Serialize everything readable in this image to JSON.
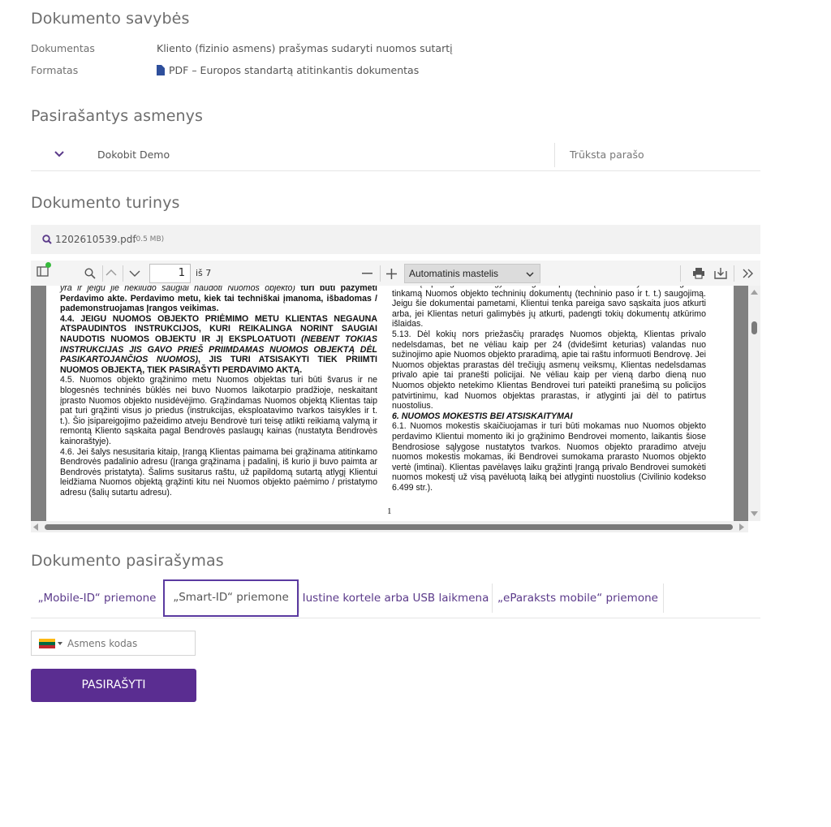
{
  "properties": {
    "title": "Dokumento savybės",
    "doc_label": "Dokumentas",
    "doc_value": "Kliento (fizinio asmens) prašymas sudaryti nuomos sutartį",
    "format_label": "Formatas",
    "format_value": "PDF – Europos standartą atitinkantis dokumentas"
  },
  "signers": {
    "title": "Pasirašantys asmenys",
    "rows": [
      {
        "name": "Dokobit Demo",
        "status": "Trūksta parašo"
      }
    ]
  },
  "content": {
    "title": "Dokumento turinys",
    "file_name": "1202610539.pdf",
    "file_size": "(0.5 MB)",
    "viewer": {
      "page_number": "1",
      "page_of": "iš 7",
      "zoom": "Automatinis mastelis",
      "page_footer": "1",
      "left_column": [
        "yra ir jeigu jie nekliudo saugiai naudoti Nuomos objekto) turi būti pažymėti Perdavimo akte. Perdavimo metu, kiek tai techniškai įmanoma, išbadomas / pademonstruojamas Įrangos veikimas.",
        "4.4. JEIGU NUOMOS OBJEKTO PRIĖMIMO METU KLIENTAS NEGAUNA ATSPAUDINTOS INSTRUKCIJOS, KURI REIKALINGA NORINT SAUGIAI NAUDOTIS NUOMOS OBJEKTU IR JĮ EKSPLOATUOTI (NEBENT TOKIAS INSTRUKCIJAS JIS GAVO PRIEŠ PRIIMDAMAS NUOMOS OBJEKTĄ DĖL PASIKARTOJANČIOS NUOMOS), JIS TURI ATSISAKYTI TIEK PRIIMTI NUOMOS OBJEKTĄ, TIEK PASIRAŠYTI PERDAVIMO AKTĄ.",
        "4.5. Nuomos objekto grąžinimo metu Nuomos objektas turi būti švarus ir ne blogesnės techninės būklės nei buvo Nuomos laikotarpio pradžioje, neskaitant įprasto Nuomos objekto nusidėvėjimo. Grąžindamas Nuomos objektą Klientas taip pat turi grąžinti visus jo priedus (instrukcijas, eksploatavimo tvarkos taisykles ir t. t.). Šio įsipareigojimo pažeidimo atveju Bendrovė turi teisę atlikti reikiamą valymą ir remontą Kliento sąskaita pagal Bendrovės paslaugų kainas (nustatyta Bendrovės kainoraštyje).",
        "4.6. Jei šalys nesusitaria kitaip, Įrangą Klientas paimama bei grąžinama atitinkamo Bendrovės padalinio adresu (Įranga grąžinama į padalinį, iš kurio ji buvo paimta ar Bendrovės pristatyta). Šalims susitarus raštu, už papildomą sutartą atlygį Klientui leidžiama Nuomos objektą grąžinti kitu nei Nuomos objekto paėmimo / pristatymo adresu (šalių sutartu adresu)."
      ],
      "right_column": [
        "ankumų apsaugos nuo vagystės ir gaisro priemonių. Klientas yra atsakingas už tinkamą Nuomos objekto techninių dokumentų (techninio paso ir t. t.) saugojimą. Jeigu šie dokumentai pametami, Klientui tenka pareiga savo sąskaita juos atkurti arba, jei Klientas neturi galimybės jų atkurti, padengti tokių dokumentų atkūrimo išlaidas.",
        "5.13. Dėl kokių nors priežasčių praradęs Nuomos objektą, Klientas privalo nedelsdamas, bet ne vėliau kaip per 24 (dvidešimt keturias) valandas nuo sužinojimo apie Nuomos objekto praradimą, apie tai raštu informuoti Bendrovę. Jei Nuomos objektas prarastas dėl trečiųjų asmenų veiksmų, Klientas nedelsdamas privalo apie tai pranešti policijai. Ne vėliau kaip per vieną darbo dieną nuo Nuomos objekto netekimo Klientas Bendrovei turi pateikti pranešimą su policijos patvirtinimu, kad Nuomos objektas prarastas, ir atlyginti jai dėl to patirtus nuostolius.",
        "6. NUOMOS MOKESTIS BEI ATSISKAITYMAI",
        "6.1. Nuomos mokestis skaičiuojamas ir turi būti mokamas nuo Nuomos objekto perdavimo Klientui momento iki jo grąžinimo Bendrovei momento, laikantis šiose Bendrosiose sąlygose nustatytos tvarkos. Nuomos objekto praradimo atveju nuomos mokestis mokamas, iki Bendrovei sumokama prarasto Nuomos objekto vertė (imtinai). Klientas pavėlavęs laiku grąžinti Įrangą privalo Bendrovei sumokėti nuomos mokestį už visą pavėluotą laiką bei atlyginti nuostolius (Civilinio kodekso 6.499 str.)."
      ]
    }
  },
  "signing": {
    "title": "Dokumento pasirašymas",
    "tabs": [
      "„Mobile-ID“ priemone",
      "„Smart-ID“ priemone",
      "Iustine kortele arba USB laikmena",
      "„eParaksts mobile“ priemone"
    ],
    "selected_tab": 1,
    "id_placeholder": "Asmens kodas",
    "country_flag_colors": [
      "#fdb913",
      "#006a44",
      "#c1272d"
    ],
    "submit_label": "PASIRAŠYTI",
    "accent": "#5a2d91"
  }
}
